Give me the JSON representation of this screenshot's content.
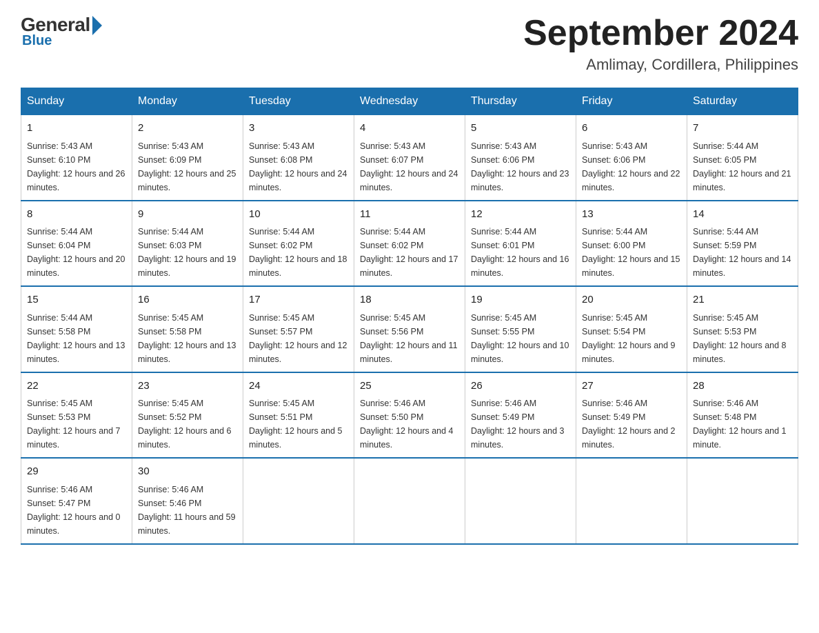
{
  "logo": {
    "general": "General",
    "blue": "Blue"
  },
  "header": {
    "month": "September 2024",
    "location": "Amlimay, Cordillera, Philippines"
  },
  "weekdays": [
    "Sunday",
    "Monday",
    "Tuesday",
    "Wednesday",
    "Thursday",
    "Friday",
    "Saturday"
  ],
  "weeks": [
    [
      {
        "day": "1",
        "sunrise": "5:43 AM",
        "sunset": "6:10 PM",
        "daylight": "12 hours and 26 minutes."
      },
      {
        "day": "2",
        "sunrise": "5:43 AM",
        "sunset": "6:09 PM",
        "daylight": "12 hours and 25 minutes."
      },
      {
        "day": "3",
        "sunrise": "5:43 AM",
        "sunset": "6:08 PM",
        "daylight": "12 hours and 24 minutes."
      },
      {
        "day": "4",
        "sunrise": "5:43 AM",
        "sunset": "6:07 PM",
        "daylight": "12 hours and 24 minutes."
      },
      {
        "day": "5",
        "sunrise": "5:43 AM",
        "sunset": "6:06 PM",
        "daylight": "12 hours and 23 minutes."
      },
      {
        "day": "6",
        "sunrise": "5:43 AM",
        "sunset": "6:06 PM",
        "daylight": "12 hours and 22 minutes."
      },
      {
        "day": "7",
        "sunrise": "5:44 AM",
        "sunset": "6:05 PM",
        "daylight": "12 hours and 21 minutes."
      }
    ],
    [
      {
        "day": "8",
        "sunrise": "5:44 AM",
        "sunset": "6:04 PM",
        "daylight": "12 hours and 20 minutes."
      },
      {
        "day": "9",
        "sunrise": "5:44 AM",
        "sunset": "6:03 PM",
        "daylight": "12 hours and 19 minutes."
      },
      {
        "day": "10",
        "sunrise": "5:44 AM",
        "sunset": "6:02 PM",
        "daylight": "12 hours and 18 minutes."
      },
      {
        "day": "11",
        "sunrise": "5:44 AM",
        "sunset": "6:02 PM",
        "daylight": "12 hours and 17 minutes."
      },
      {
        "day": "12",
        "sunrise": "5:44 AM",
        "sunset": "6:01 PM",
        "daylight": "12 hours and 16 minutes."
      },
      {
        "day": "13",
        "sunrise": "5:44 AM",
        "sunset": "6:00 PM",
        "daylight": "12 hours and 15 minutes."
      },
      {
        "day": "14",
        "sunrise": "5:44 AM",
        "sunset": "5:59 PM",
        "daylight": "12 hours and 14 minutes."
      }
    ],
    [
      {
        "day": "15",
        "sunrise": "5:44 AM",
        "sunset": "5:58 PM",
        "daylight": "12 hours and 13 minutes."
      },
      {
        "day": "16",
        "sunrise": "5:45 AM",
        "sunset": "5:58 PM",
        "daylight": "12 hours and 13 minutes."
      },
      {
        "day": "17",
        "sunrise": "5:45 AM",
        "sunset": "5:57 PM",
        "daylight": "12 hours and 12 minutes."
      },
      {
        "day": "18",
        "sunrise": "5:45 AM",
        "sunset": "5:56 PM",
        "daylight": "12 hours and 11 minutes."
      },
      {
        "day": "19",
        "sunrise": "5:45 AM",
        "sunset": "5:55 PM",
        "daylight": "12 hours and 10 minutes."
      },
      {
        "day": "20",
        "sunrise": "5:45 AM",
        "sunset": "5:54 PM",
        "daylight": "12 hours and 9 minutes."
      },
      {
        "day": "21",
        "sunrise": "5:45 AM",
        "sunset": "5:53 PM",
        "daylight": "12 hours and 8 minutes."
      }
    ],
    [
      {
        "day": "22",
        "sunrise": "5:45 AM",
        "sunset": "5:53 PM",
        "daylight": "12 hours and 7 minutes."
      },
      {
        "day": "23",
        "sunrise": "5:45 AM",
        "sunset": "5:52 PM",
        "daylight": "12 hours and 6 minutes."
      },
      {
        "day": "24",
        "sunrise": "5:45 AM",
        "sunset": "5:51 PM",
        "daylight": "12 hours and 5 minutes."
      },
      {
        "day": "25",
        "sunrise": "5:46 AM",
        "sunset": "5:50 PM",
        "daylight": "12 hours and 4 minutes."
      },
      {
        "day": "26",
        "sunrise": "5:46 AM",
        "sunset": "5:49 PM",
        "daylight": "12 hours and 3 minutes."
      },
      {
        "day": "27",
        "sunrise": "5:46 AM",
        "sunset": "5:49 PM",
        "daylight": "12 hours and 2 minutes."
      },
      {
        "day": "28",
        "sunrise": "5:46 AM",
        "sunset": "5:48 PM",
        "daylight": "12 hours and 1 minute."
      }
    ],
    [
      {
        "day": "29",
        "sunrise": "5:46 AM",
        "sunset": "5:47 PM",
        "daylight": "12 hours and 0 minutes."
      },
      {
        "day": "30",
        "sunrise": "5:46 AM",
        "sunset": "5:46 PM",
        "daylight": "11 hours and 59 minutes."
      },
      null,
      null,
      null,
      null,
      null
    ]
  ]
}
